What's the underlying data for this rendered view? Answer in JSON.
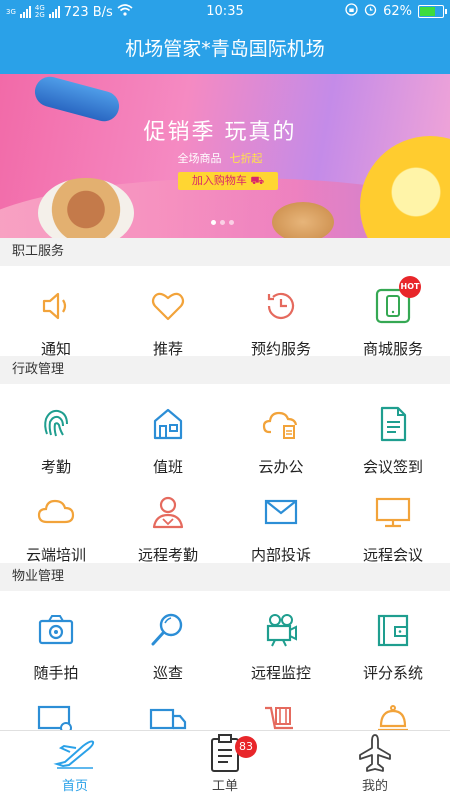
{
  "status_bar": {
    "network_left": "3G",
    "network_right": "4G",
    "network_sub": "2G",
    "speed": "723 B/s",
    "time": "10:35",
    "battery": "62%",
    "battery_level": 0.62
  },
  "app": {
    "title": "机场管家*青岛国际机场"
  },
  "banner": {
    "slogan": "促销季 玩真的",
    "sub_text": "全场商品",
    "discount": "七折起",
    "cta": "加入购物车",
    "page_count": 3,
    "active_page": 1
  },
  "sections": [
    {
      "title": "职工服务",
      "items": [
        {
          "label": "通知",
          "icon": "speaker-icon"
        },
        {
          "label": "推荐",
          "icon": "heart-icon"
        },
        {
          "label": "预约服务",
          "icon": "clock-history-icon"
        },
        {
          "label": "商城服务",
          "icon": "phone-icon",
          "badge": "HOT"
        }
      ]
    },
    {
      "title": "行政管理",
      "items": [
        {
          "label": "考勤",
          "icon": "fingerprint-icon"
        },
        {
          "label": "值班",
          "icon": "house-icon"
        },
        {
          "label": "云办公",
          "icon": "cloud-doc-icon"
        },
        {
          "label": "会议签到",
          "icon": "document-icon"
        },
        {
          "label": "云端培训",
          "icon": "cloud-icon"
        },
        {
          "label": "远程考勤",
          "icon": "user-icon"
        },
        {
          "label": "内部投诉",
          "icon": "mail-icon"
        },
        {
          "label": "远程会议",
          "icon": "monitor-icon"
        }
      ]
    },
    {
      "title": "物业管理",
      "items": [
        {
          "label": "随手拍",
          "icon": "camera-icon"
        },
        {
          "label": "巡查",
          "icon": "magnifier-icon"
        },
        {
          "label": "远程监控",
          "icon": "video-camera-icon"
        },
        {
          "label": "评分系统",
          "icon": "wallet-icon"
        },
        {
          "label": "",
          "icon": "monitor-gear-icon"
        },
        {
          "label": "",
          "icon": "truck-icon"
        },
        {
          "label": "",
          "icon": "cart-icon"
        },
        {
          "label": "",
          "icon": "bell-icon"
        }
      ]
    }
  ],
  "tabbar": {
    "items": [
      {
        "label": "首页",
        "icon": "plane-icon",
        "active": true
      },
      {
        "label": "工单",
        "icon": "clipboard-icon",
        "badge": "83"
      },
      {
        "label": "我的",
        "icon": "plane-outline-icon"
      }
    ]
  },
  "colors": {
    "primary": "#2aa1e8",
    "orange": "#f2a33a",
    "teal": "#1f9e8f",
    "blue": "#2c8ed6",
    "red": "#e56a5e",
    "badge": "#e8262a"
  }
}
